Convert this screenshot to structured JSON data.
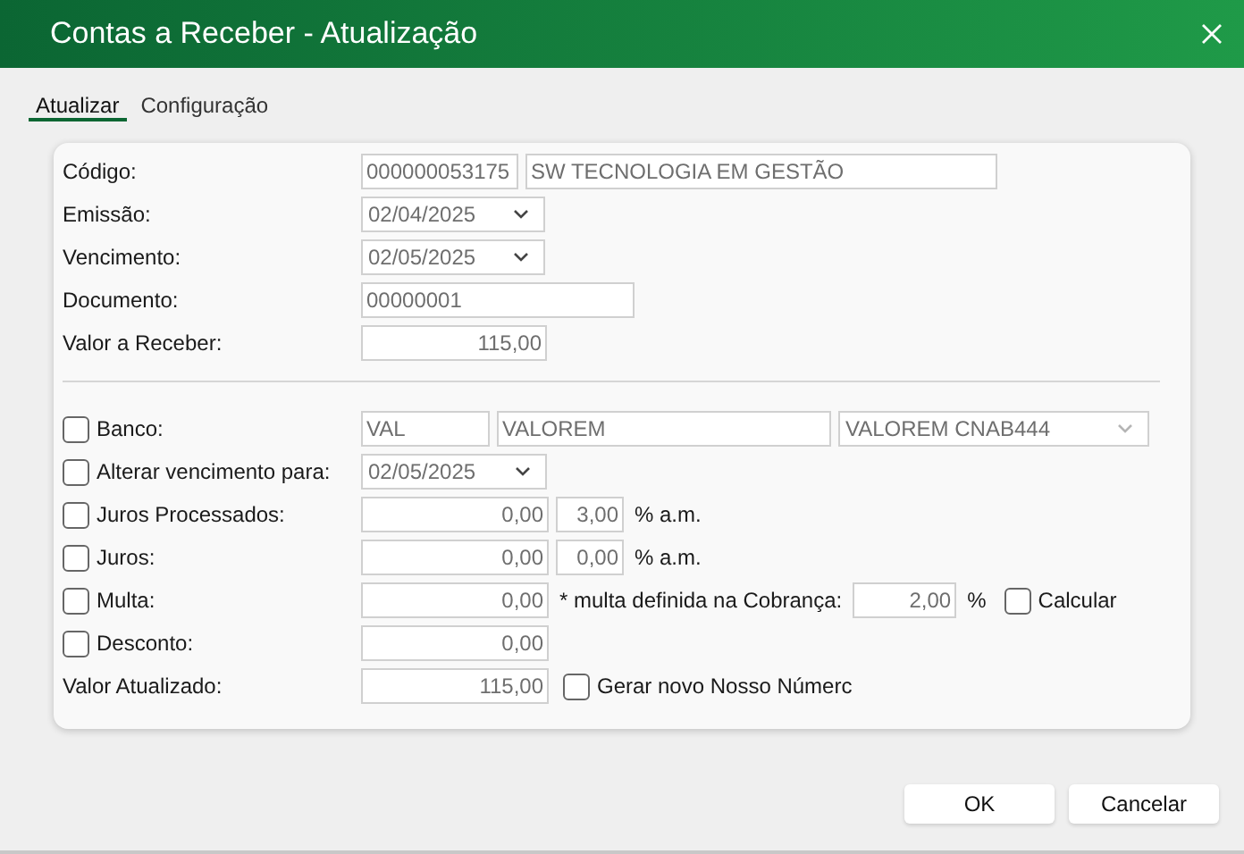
{
  "window": {
    "title": "Contas a Receber - Atualização"
  },
  "tabs": [
    {
      "label": "Atualizar",
      "selected": true
    },
    {
      "label": "Configuração",
      "selected": false
    }
  ],
  "main_fields": [
    {
      "label": "Código:",
      "inputs": [
        {
          "kind": "text",
          "value": "000000053175"
        },
        {
          "kind": "text",
          "value": "SW TECNOLOGIA EM GESTÃO"
        }
      ]
    },
    {
      "label": "Emissão:",
      "inputs": [
        {
          "kind": "date",
          "value": "02/04/2025"
        }
      ]
    },
    {
      "label": "Vencimento:",
      "inputs": [
        {
          "kind": "date",
          "value": "02/05/2025"
        }
      ]
    },
    {
      "label": "Documento:",
      "inputs": [
        {
          "kind": "text",
          "value": "00000001"
        }
      ]
    },
    {
      "label": "Valor a Receber:",
      "inputs": [
        {
          "kind": "number",
          "value": "115,00"
        }
      ]
    }
  ],
  "adjust_rows": [
    {
      "kind": "check",
      "label": "Banco:",
      "checked": false,
      "parts": [
        {
          "kind": "text",
          "value": "VAL"
        },
        {
          "kind": "text",
          "value": "VALOREM"
        },
        {
          "kind": "select",
          "value": "VALOREM CNAB444"
        }
      ]
    },
    {
      "kind": "check",
      "label": "Alterar vencimento para:",
      "checked": false,
      "parts": [
        {
          "kind": "date",
          "value": "02/05/2025"
        }
      ]
    },
    {
      "kind": "check",
      "label": "Juros Processados:",
      "checked": false,
      "parts": [
        {
          "kind": "number",
          "value": "0,00"
        },
        {
          "kind": "number",
          "value": "3,00"
        },
        {
          "kind": "note",
          "text": "% a.m."
        }
      ]
    },
    {
      "kind": "check",
      "label": "Juros:",
      "checked": false,
      "parts": [
        {
          "kind": "number",
          "value": "0,00"
        },
        {
          "kind": "number",
          "value": "0,00"
        },
        {
          "kind": "note",
          "text": "% a.m."
        }
      ]
    },
    {
      "kind": "check",
      "label": "Multa:",
      "checked": false,
      "parts": [
        {
          "kind": "number",
          "value": "0,00"
        },
        {
          "kind": "note",
          "text": "* multa definida na Cobrança:"
        },
        {
          "kind": "number",
          "value": "2,00"
        },
        {
          "kind": "note",
          "text": "%"
        },
        {
          "kind": "checkbox",
          "label": "Calcular",
          "checked": false
        }
      ]
    },
    {
      "kind": "check",
      "label": "Desconto:",
      "checked": false,
      "parts": [
        {
          "kind": "number",
          "value": "0,00"
        }
      ]
    },
    {
      "kind": "plain",
      "label": "Valor Atualizado:",
      "parts": [
        {
          "kind": "number",
          "value": "115,00"
        },
        {
          "kind": "checkbox",
          "label": "Gerar novo Nosso Númerc",
          "checked": false
        }
      ]
    }
  ],
  "buttons": [
    "OK",
    "Cancelar"
  ]
}
